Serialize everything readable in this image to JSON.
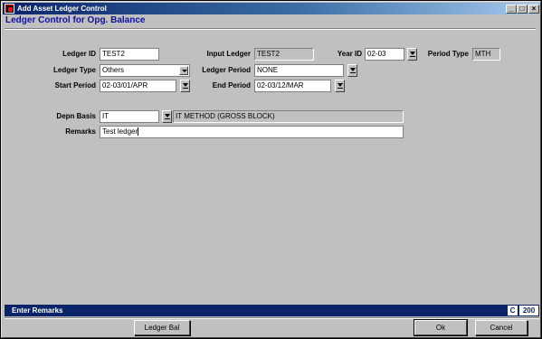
{
  "window": {
    "title": "Add Asset Ledger Control",
    "subtitle": "Ledger Control for Opg. Balance",
    "minimize_glyph": "_",
    "maximize_glyph": "□",
    "close_glyph": "×"
  },
  "form": {
    "ledger_id": {
      "label": "Ledger ID",
      "value": "TEST2"
    },
    "input_ledger": {
      "label": "Input Ledger",
      "value": "TEST2"
    },
    "year_id": {
      "label": "Year ID",
      "value": "02-03"
    },
    "period_type": {
      "label": "Period Type",
      "value": "MTH"
    },
    "ledger_type": {
      "label": "Ledger Type",
      "value": "Others"
    },
    "ledger_period": {
      "label": "Ledger Period",
      "value": "NONE"
    },
    "start_period": {
      "label": "Start Period",
      "value": "02-03/01/APR"
    },
    "end_period": {
      "label": "End Period",
      "value": "02-03/12/MAR"
    },
    "depn_basis": {
      "label": "Depn Basis",
      "value": "IT",
      "description": "IT METHOD (GROSS BLOCK)"
    },
    "remarks": {
      "label": "Remarks",
      "value": "Test ledger"
    }
  },
  "statusbar": {
    "message": "Enter Remarks",
    "mode": "C",
    "count": "200"
  },
  "buttons": {
    "ledger_bal": "Ledger Bal",
    "ok": "Ok",
    "cancel": "Cancel"
  },
  "colors": {
    "title_bar": "#0a246a",
    "subtitle_text": "#1010a0",
    "face": "#c0c0c0",
    "status_bar": "#0a246a"
  }
}
